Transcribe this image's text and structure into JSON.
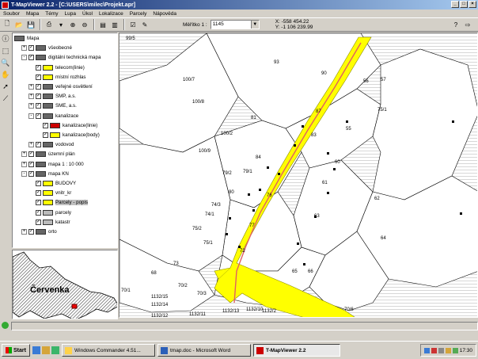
{
  "window": {
    "title": "T-MapViewer 2.2 - [C:\\USERS\\milec\\Projekt.apr]"
  },
  "menu": [
    "Soubor",
    "Mapa",
    "Témy",
    "Lupa",
    "Úkol",
    "Lokalizace",
    "Parcely",
    "Nápověda"
  ],
  "toolbar": {
    "scale_label": "Měřítko 1 :",
    "scale_value": "1145",
    "coord_x": "X: -558 454.22",
    "coord_y": "Y: -1 106 239.99"
  },
  "layers": [
    {
      "label": "Mapa",
      "level": 0,
      "icon": "folder"
    },
    {
      "label": "všeobecné",
      "level": 1,
      "icon": "folder",
      "expander": "+"
    },
    {
      "label": "digitální technická mapa",
      "level": 1,
      "icon": "folder",
      "expander": "-"
    },
    {
      "label": "telecom(linie)",
      "level": 2,
      "icon": "yellow"
    },
    {
      "label": "místní rozhlas",
      "level": 2,
      "icon": "yellow"
    },
    {
      "label": "veřejné osvětlení",
      "level": 2,
      "icon": "folder",
      "expander": "+"
    },
    {
      "label": "SMP, a.s.",
      "level": 2,
      "icon": "folder",
      "expander": "+"
    },
    {
      "label": "SME, a.s.",
      "level": 2,
      "icon": "folder",
      "expander": "+"
    },
    {
      "label": "kanalizace",
      "level": 2,
      "icon": "folder",
      "expander": "-"
    },
    {
      "label": "kanalizace(linie)",
      "level": 3,
      "icon": "red"
    },
    {
      "label": "kanalizace(body)",
      "level": 3,
      "icon": "yellow"
    },
    {
      "label": "vodovod",
      "level": 2,
      "icon": "folder",
      "expander": "+"
    },
    {
      "label": "územní plán",
      "level": 1,
      "icon": "folder",
      "expander": "+"
    },
    {
      "label": "mapa 1 : 10 000",
      "level": 1,
      "icon": "folder",
      "expander": "+"
    },
    {
      "label": "mapa KN",
      "level": 1,
      "icon": "folder",
      "expander": "-"
    },
    {
      "label": "BUDOVY",
      "level": 2,
      "icon": "yellow"
    },
    {
      "label": "vnitr_kr",
      "level": 2,
      "icon": "yellow"
    },
    {
      "label": "Parcely - popis",
      "level": 2,
      "icon": "yellow",
      "selected": true
    },
    {
      "label": "parcely",
      "level": 2,
      "icon": "gray"
    },
    {
      "label": "katastr",
      "level": 2,
      "icon": "gray"
    },
    {
      "label": "orto",
      "level": 1,
      "icon": "folder",
      "expander": "+"
    }
  ],
  "overview": {
    "town": "Červenka"
  },
  "map_labels": [
    "99/5",
    "100/7",
    "100/8",
    "100/9",
    "100/2",
    "93",
    "90",
    "56",
    "57",
    "75/1",
    "87",
    "81",
    "55",
    "84",
    "83",
    "60",
    "61",
    "79/2",
    "79/1",
    "80",
    "76",
    "77",
    "74/3",
    "74/1",
    "75/2",
    "75/1",
    "73",
    "72",
    "63",
    "62",
    "64",
    "65",
    "66",
    "70/3",
    "70/2",
    "70/1",
    "68",
    "1132/15",
    "1132/14",
    "1132/11",
    "1132/12",
    "1132/13",
    "1132/10",
    "1132/2",
    "70/6"
  ],
  "taskbar": {
    "start": "Start",
    "tasks": [
      "Windows Commander 4.51...",
      "tmap.doc - Microsoft Word",
      "T-MapViewer 2.2"
    ],
    "clock": "17:30"
  },
  "colors": {
    "road": "#ffff00",
    "parcel_lines": "#000000",
    "road_centerline": "#e06060"
  }
}
